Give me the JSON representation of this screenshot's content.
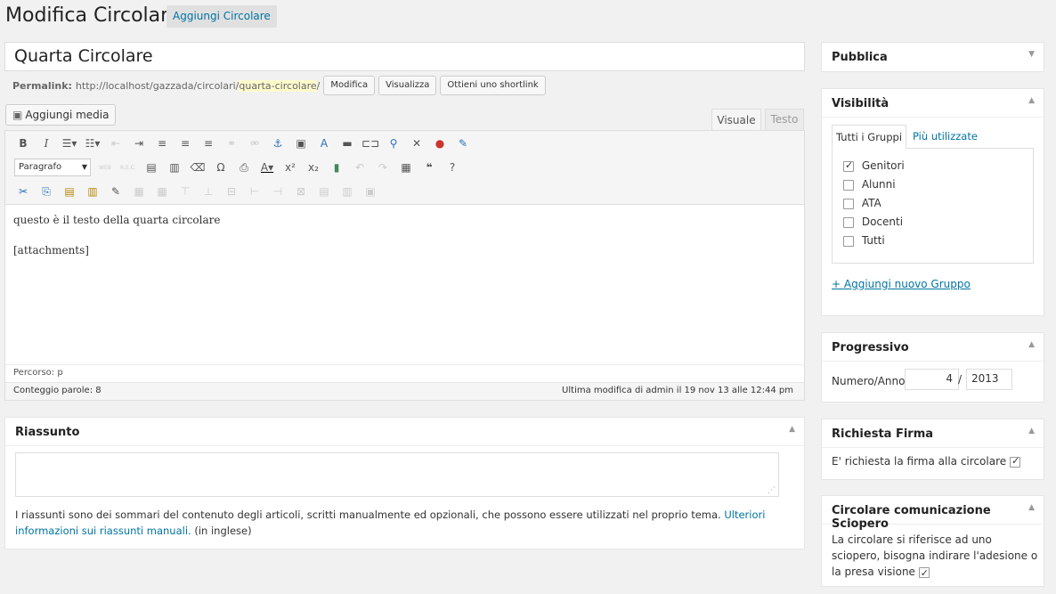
{
  "header": {
    "title": "Modifica Circolare",
    "add_button": "Aggiungi Circolare"
  },
  "post": {
    "title": "Quarta Circolare",
    "permalink_label": "Permalink:",
    "permalink_base": "http://localhost/gazzada/circolari/",
    "permalink_slug": "quarta-circolare",
    "permalink_tail": "/",
    "btn_edit": "Modifica",
    "btn_view": "Visualizza",
    "btn_shortlink": "Ottieni uno shortlink"
  },
  "editor": {
    "add_media": "Aggiungi media",
    "tab_visual": "Visuale",
    "tab_text": "Testo",
    "format_select": "Paragrafo",
    "content_line1": "questo è il testo della quarta circolare",
    "content_line2": "[attachments]",
    "path": "Percorso: p",
    "word_count": "Conteggio parole: 8",
    "last_modified": "Ultima modifica di admin il 19 nov 13 alle 12:44 pm"
  },
  "excerpt": {
    "title": "Riassunto",
    "help_text": "I riassunti sono dei sommari del contenuto degli articoli, scritti manualmente ed opzionali, che possono essere utilizzati nel proprio tema. ",
    "help_link": "Ulteriori informazioni sui riassunti manuali.",
    "help_suffix": " (in inglese)"
  },
  "publish": {
    "title": "Pubblica"
  },
  "visibility": {
    "title": "Visibilità",
    "tab_all": "Tutti i Gruppi",
    "tab_most_used": "Più utilizzate",
    "groups": [
      {
        "label": "Genitori",
        "checked": true
      },
      {
        "label": "Alunni",
        "checked": false
      },
      {
        "label": "ATA",
        "checked": false
      },
      {
        "label": "Docenti",
        "checked": false
      },
      {
        "label": "Tutti",
        "checked": false
      }
    ],
    "add_group": "+ Aggiungi nuovo Gruppo"
  },
  "progressive": {
    "title": "Progressivo",
    "label": "Numero/Anno",
    "number": "4",
    "separator": "/",
    "year": "2013"
  },
  "signature": {
    "title": "Richiesta Firma",
    "label": "E' richiesta la firma alla circolare"
  },
  "strike": {
    "title": "Circolare comunicazione Sciopero",
    "label": "La circolare si riferisce ad uno sciopero, bisogna indirare l'adesione o la presa visione"
  }
}
